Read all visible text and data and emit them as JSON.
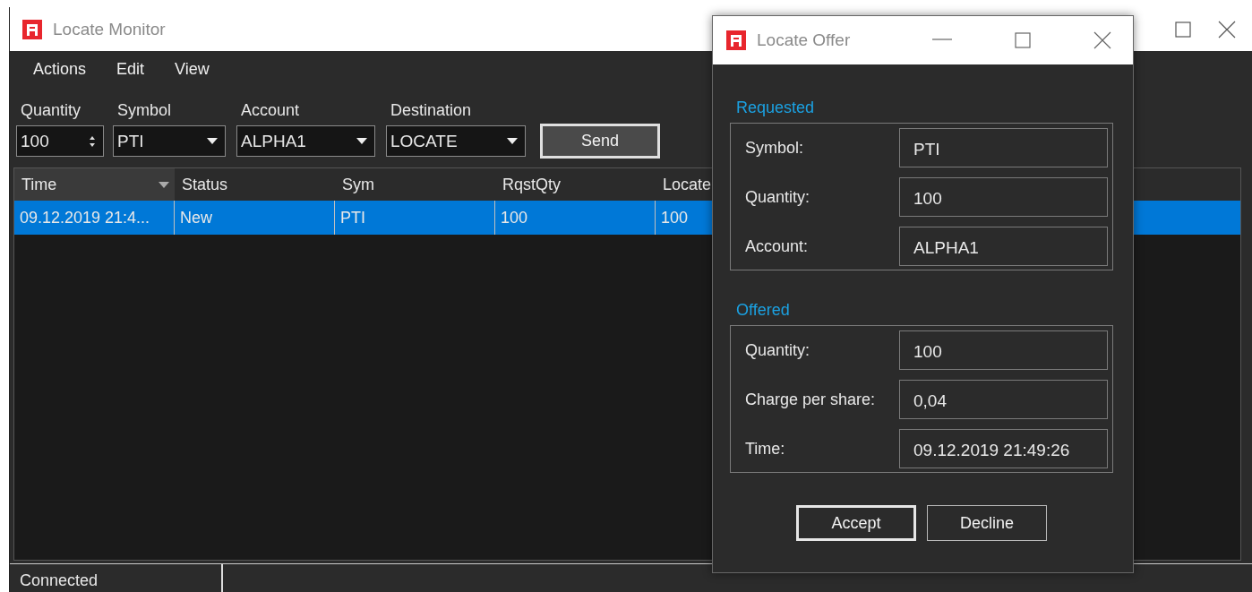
{
  "main_window": {
    "title": "Locate Monitor",
    "menu": [
      "Actions",
      "Edit",
      "View"
    ],
    "order_form": {
      "fields": [
        {
          "kind": "spinner",
          "label": "Quantity",
          "value": "100"
        },
        {
          "kind": "dropdown",
          "label": "Symbol",
          "value": "PTI"
        },
        {
          "kind": "dropdown",
          "label": "Account",
          "value": "ALPHA1"
        },
        {
          "kind": "dropdown",
          "label": "Destination",
          "value": "LOCATE"
        }
      ],
      "send_button": "Send"
    },
    "table": {
      "columns": [
        {
          "label": "Time",
          "sorted": true
        },
        {
          "label": "Status",
          "sorted": false
        },
        {
          "label": "Sym",
          "sorted": false
        },
        {
          "label": "RqstQty",
          "sorted": false
        },
        {
          "label": "Locate",
          "sorted": false
        }
      ],
      "rows": [
        {
          "selected": true,
          "cells": [
            "09.12.2019 21:4...",
            "New",
            "PTI",
            "100",
            "100"
          ]
        }
      ]
    },
    "status_bar": [
      "Connected"
    ]
  },
  "dialog": {
    "title": "Locate Offer",
    "groups": [
      {
        "title": "Requested",
        "fields": [
          {
            "label": "Symbol:",
            "value": "PTI"
          },
          {
            "label": "Quantity:",
            "value": "100"
          },
          {
            "label": "Account:",
            "value": "ALPHA1"
          }
        ]
      },
      {
        "title": "Offered",
        "fields": [
          {
            "label": "Quantity:",
            "value": "100"
          },
          {
            "label": "Charge per share:",
            "value": "0,04"
          },
          {
            "label": "Time:",
            "value": "09.12.2019 21:49:26"
          }
        ]
      }
    ],
    "buttons": [
      {
        "label": "Accept",
        "default": true
      },
      {
        "label": "Decline",
        "default": false
      }
    ]
  }
}
